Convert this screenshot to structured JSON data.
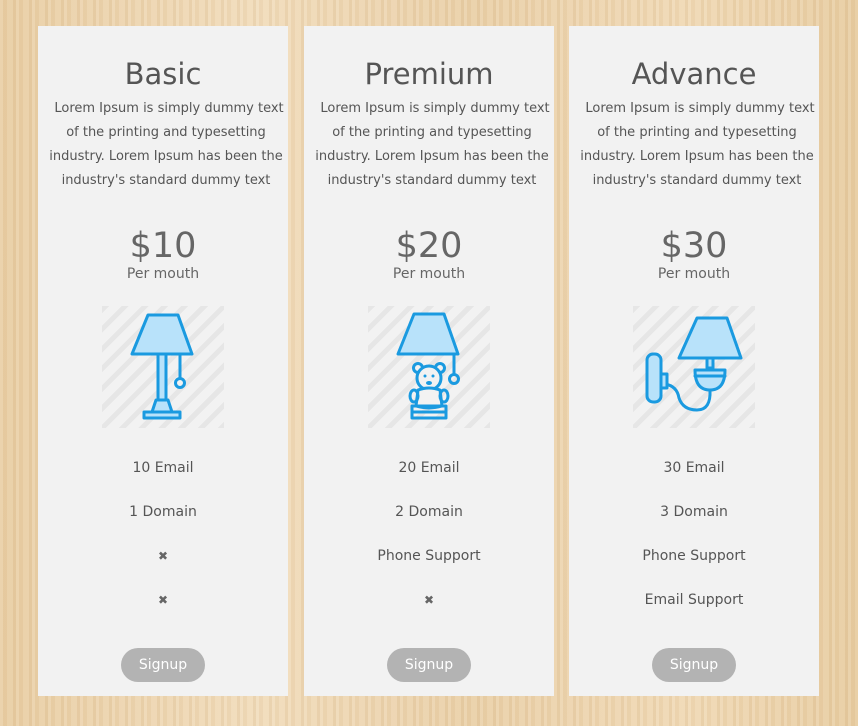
{
  "plans": [
    {
      "title": "Basic",
      "description": "Lorem Ipsum is simply dummy text of the printing and typesetting industry. Lorem Ipsum has been the industry's standard dummy text",
      "price": "$10",
      "period": "Per mouth",
      "icon": "table-lamp-icon",
      "features": [
        "10 Email",
        "1 Domain",
        "✖",
        "✖"
      ],
      "button": "Signup"
    },
    {
      "title": "Premium",
      "description": "Lorem Ipsum is simply dummy text of the printing and typesetting industry. Lorem Ipsum has been the industry's standard dummy text",
      "price": "$20",
      "period": "Per mouth",
      "icon": "bear-lamp-icon",
      "features": [
        "20 Email",
        "2 Domain",
        "Phone Support",
        "✖"
      ],
      "button": "Signup"
    },
    {
      "title": "Advance",
      "description": "Lorem Ipsum is simply dummy text of the printing and typesetting industry. Lorem Ipsum has been the industry's standard dummy text",
      "price": "$30",
      "period": "Per mouth",
      "icon": "wall-lamp-icon",
      "features": [
        "30 Email",
        "3 Domain",
        "Phone Support",
        "Email Support"
      ],
      "button": "Signup"
    }
  ],
  "colors": {
    "icon_stroke": "#1a9ae0",
    "icon_fill": "#b8e2fa",
    "card_bg": "#f2f2f2",
    "button_bg": "#b3b3b3"
  }
}
